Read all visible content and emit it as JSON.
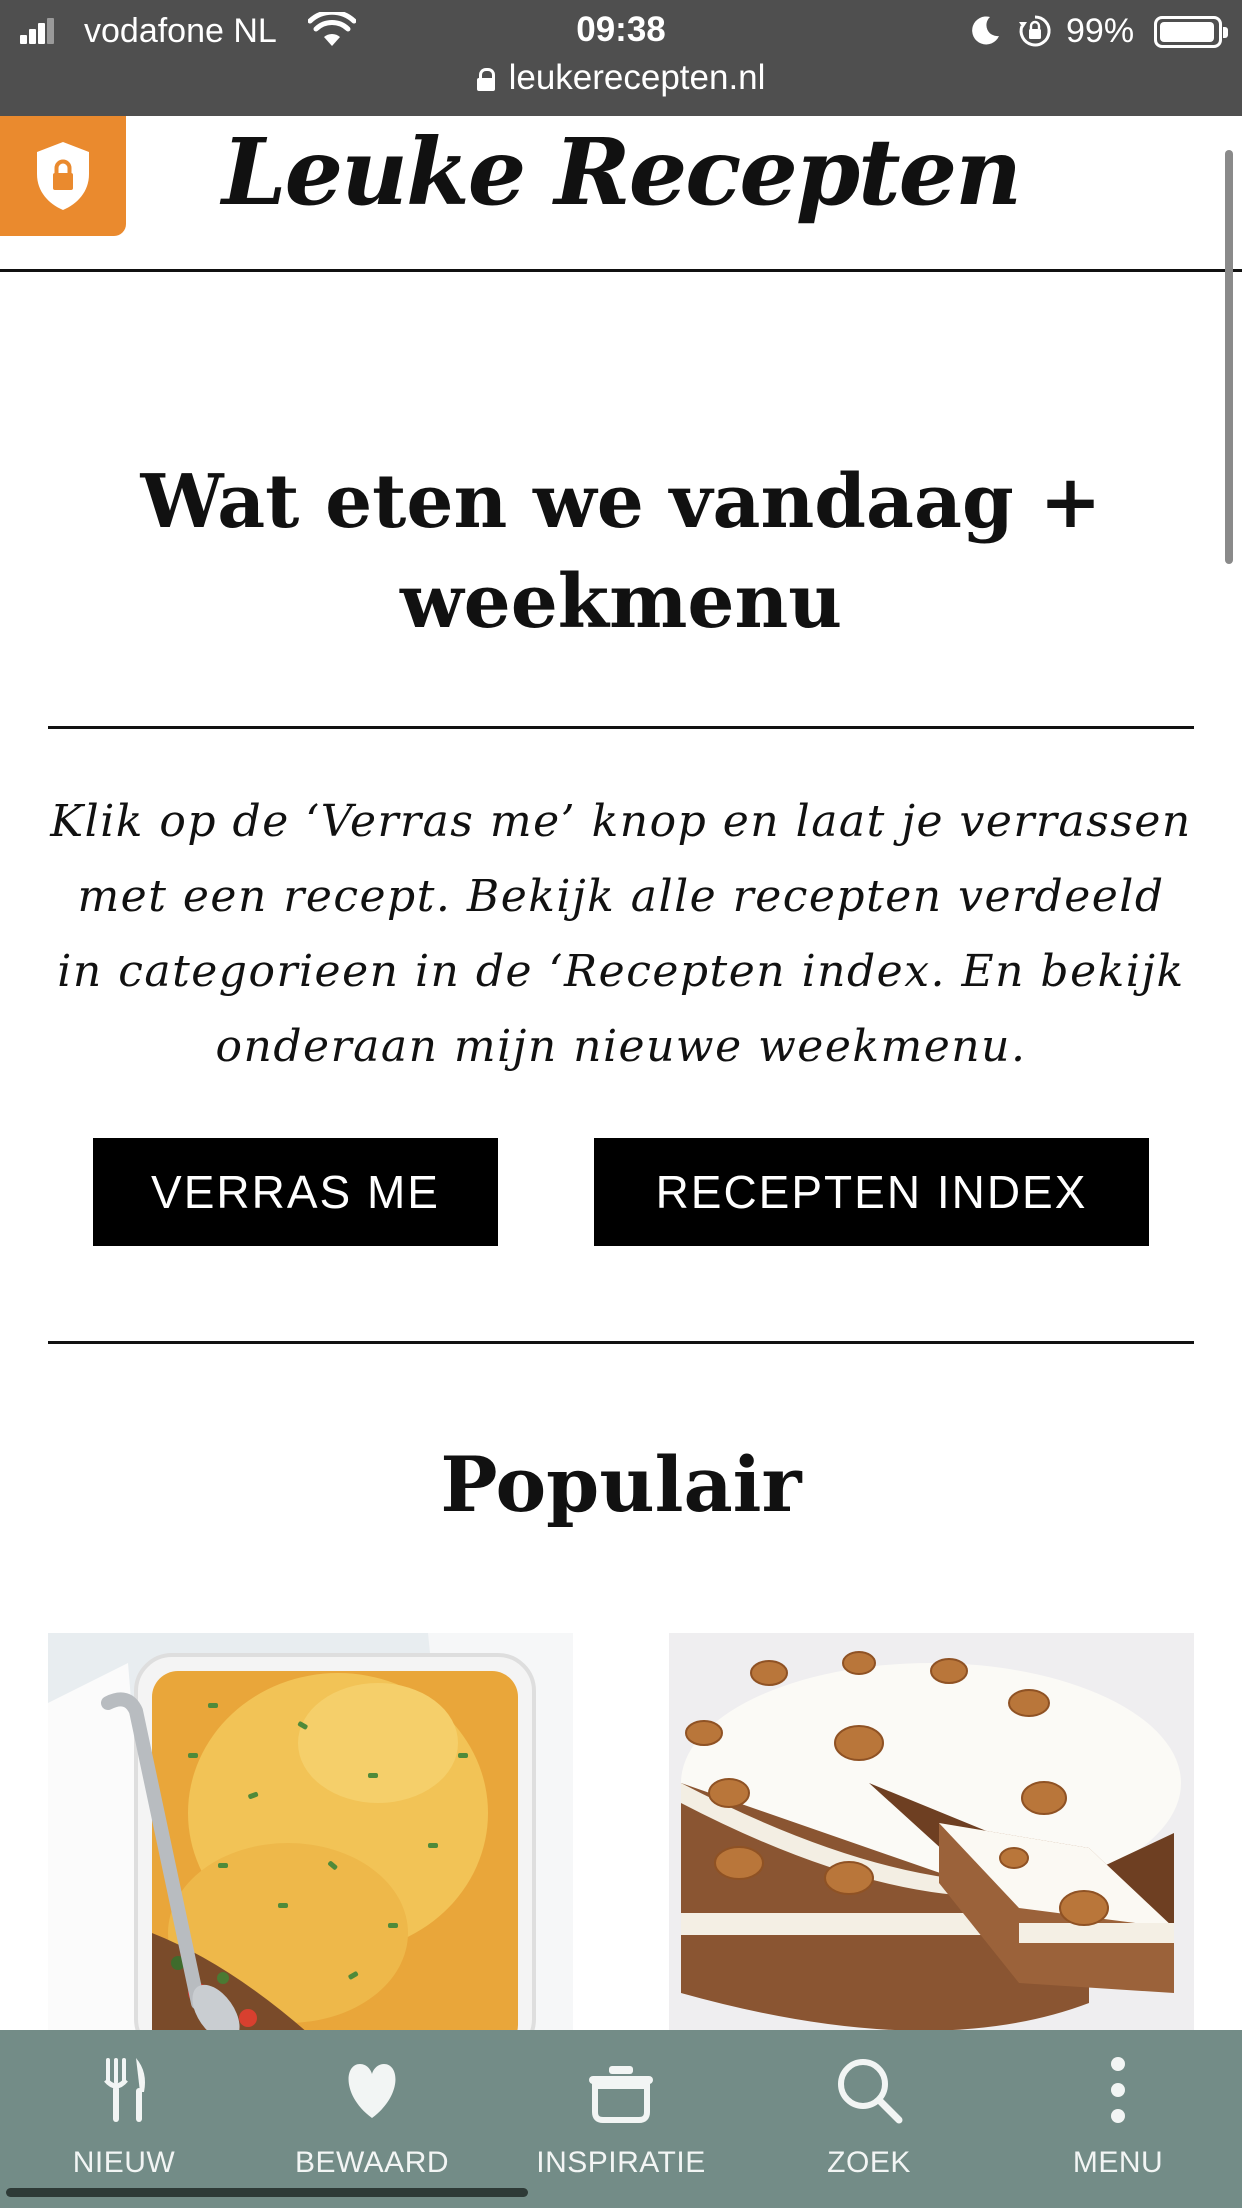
{
  "status_bar": {
    "carrier": "vodafone NL",
    "time": "09:38",
    "battery": "99%",
    "battery_level": 0.99,
    "signal_bars": 3,
    "url": "leukerecepten.nl"
  },
  "header": {
    "logo": "Leuke Recepten",
    "security_icon": "shield-lock-icon",
    "accent_color": "#ea8a2e"
  },
  "main": {
    "title": "Wat eten we vandaag + weekmenu",
    "intro": "Klik op de ‘Verras me’ knop en laat je verrassen met een recept. Bekijk alle recepten verdeeld in categorieen in de ‘Recepten index. En bekijk onderaan mijn nieuwe weekmenu.",
    "buttons": {
      "surprise": "VERRAS ME",
      "index": "RECEPTEN INDEX"
    },
    "popular_title": "Populair",
    "cards": [
      {
        "image": "cheesy casserole with spoon"
      },
      {
        "image": "carrot cake with walnuts and frosting"
      }
    ]
  },
  "tab_bar": {
    "color": "#738c87",
    "tabs": [
      {
        "label": "NIEUW",
        "icon": "fork-knife-icon"
      },
      {
        "label": "BEWAARD",
        "icon": "heart-icon"
      },
      {
        "label": "INSPIRATIE",
        "icon": "pot-icon"
      },
      {
        "label": "ZOEK",
        "icon": "search-icon"
      },
      {
        "label": "MENU",
        "icon": "more-vertical-icon"
      }
    ]
  }
}
